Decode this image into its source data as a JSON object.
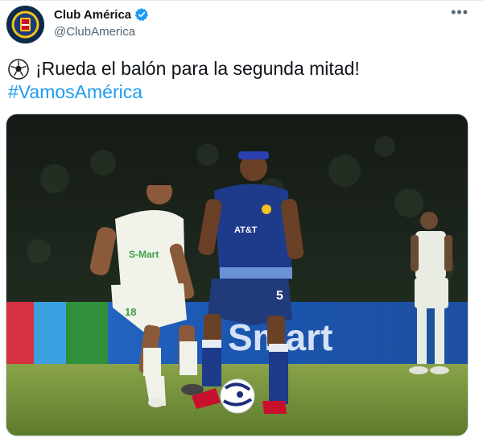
{
  "account": {
    "display_name": "Club América",
    "handle": "@ClubAmerica",
    "avatar_icon": "club-america-crest-icon",
    "verified_icon": "verified-badge-icon"
  },
  "menu": {
    "more_label": "•••"
  },
  "tweet": {
    "emoji_icon": "soccer-ball-icon",
    "text": "¡Rueda el balón para la segunda mitad!",
    "hashtag": "#VamosAmérica"
  },
  "media": {
    "sponsor_left": "S-Mart",
    "sponsor_board": "Smart",
    "jersey_sponsor": "AT&T",
    "player_number_blue": "5",
    "player_number_white": "18",
    "colors": {
      "america_kit": "#1e3a8a",
      "opponent_kit": "#f1f3ea",
      "pitch": "#6f8f3a"
    }
  },
  "colors": {
    "link": "#1d9bf0",
    "text": "#0f1419",
    "muted": "#536471"
  }
}
